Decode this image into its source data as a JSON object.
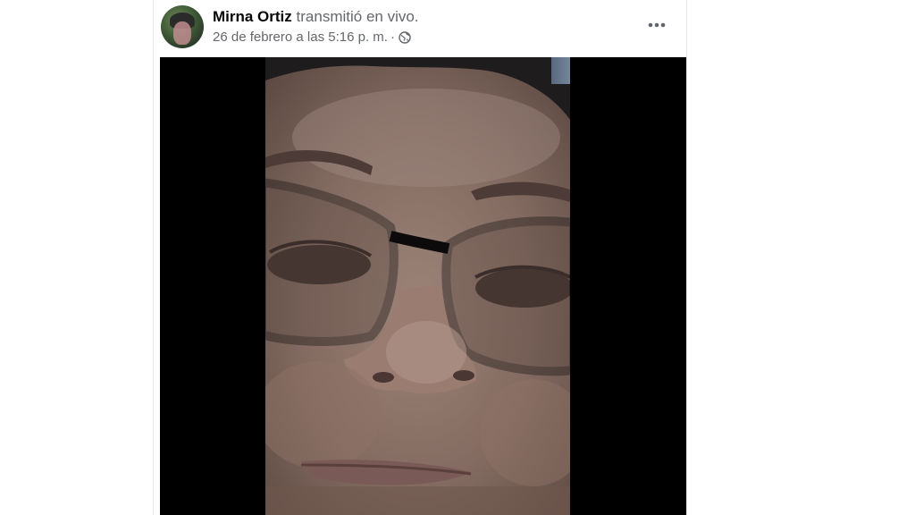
{
  "post": {
    "author_name": "Mirna Ortiz",
    "action_text": "transmitió en vivo.",
    "timestamp": "26 de febrero a las 5:16 p. m.",
    "separator": "·",
    "privacy_icon": "globe-icon",
    "menu_icon": "more-options-icon"
  },
  "video": {
    "type": "live-video",
    "description_icon": "face-closeup-video-frame"
  },
  "colors": {
    "name_text": "#050505",
    "secondary_text": "#65676b",
    "video_background": "#000000"
  }
}
